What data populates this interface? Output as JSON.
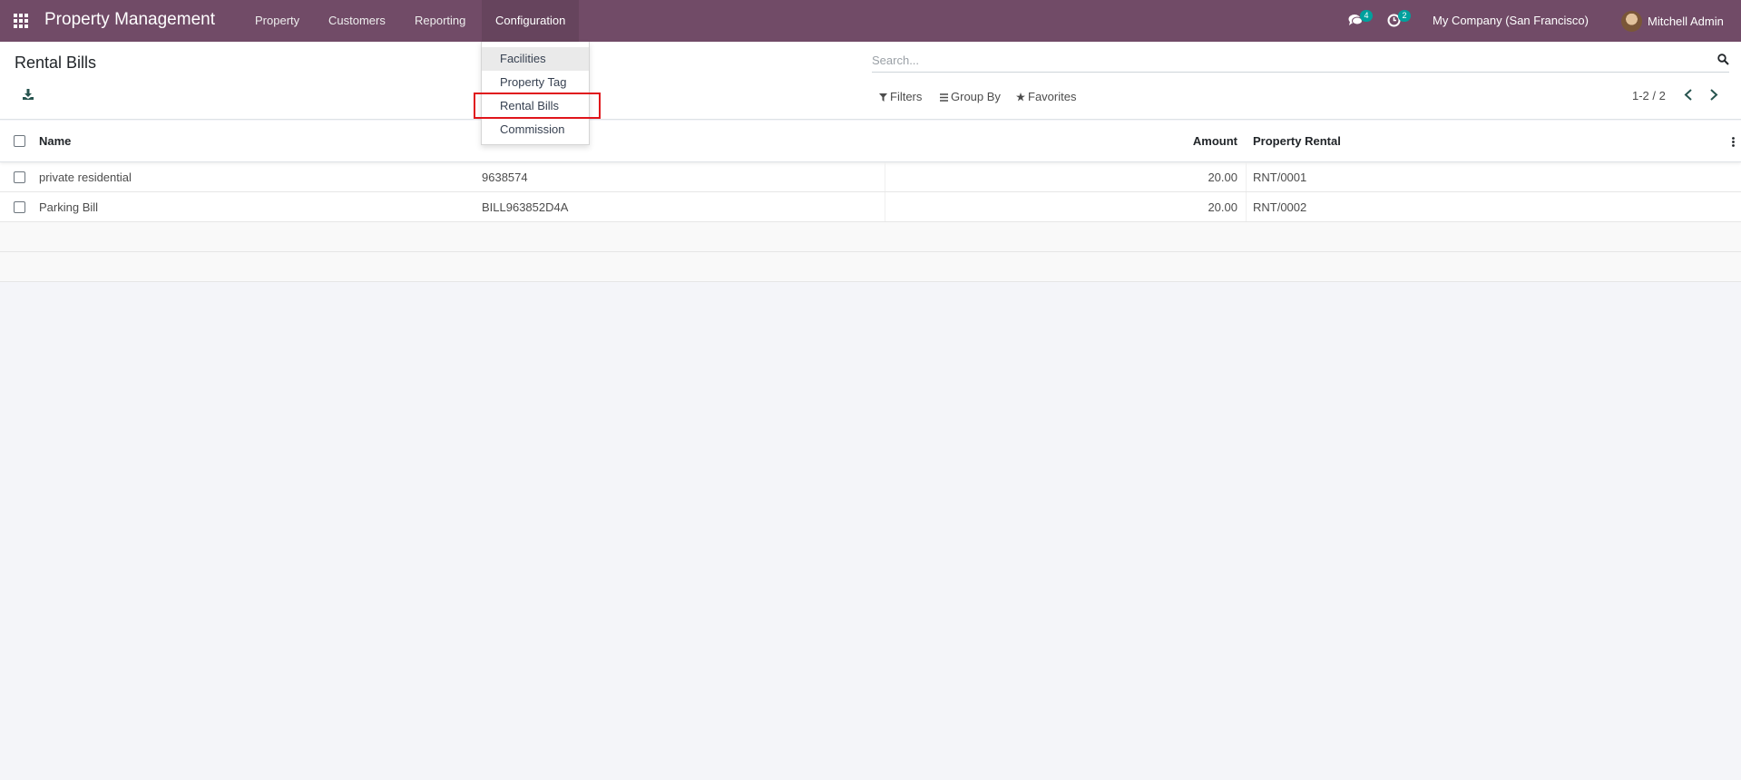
{
  "navbar": {
    "brand": "Property Management",
    "menu": [
      "Property",
      "Customers",
      "Reporting",
      "Configuration"
    ],
    "messages_count": "4",
    "activities_count": "2",
    "company": "My Company (San Francisco)",
    "user": "Mitchell Admin",
    "color": "#714b67"
  },
  "dropdown": {
    "items": [
      "Facilities",
      "Property Tag",
      "Rental Bills",
      "Commission"
    ],
    "highlighted": "Rental Bills"
  },
  "control_panel": {
    "title": "Rental Bills",
    "search_placeholder": "Search...",
    "filters_label": "Filters",
    "group_by_label": "Group By",
    "favorites_label": "Favorites",
    "pager": "1-2 / 2"
  },
  "list": {
    "columns": {
      "name": "Name",
      "amount": "Amount",
      "property_rental": "Property Rental"
    },
    "rows": [
      {
        "name": "private residential",
        "ref": "9638574",
        "amount": "20.00",
        "property_rental": "RNT/0001"
      },
      {
        "name": "Parking Bill",
        "ref": "BILL963852D4A",
        "amount": "20.00",
        "property_rental": "RNT/0002"
      }
    ]
  },
  "icons": [
    "apps-icon",
    "chat-icon",
    "clock-icon",
    "download-icon",
    "search-icon",
    "filter-icon",
    "group-by-icon",
    "star-icon",
    "chevron-left-icon",
    "chevron-right-icon",
    "kebab-icon"
  ]
}
